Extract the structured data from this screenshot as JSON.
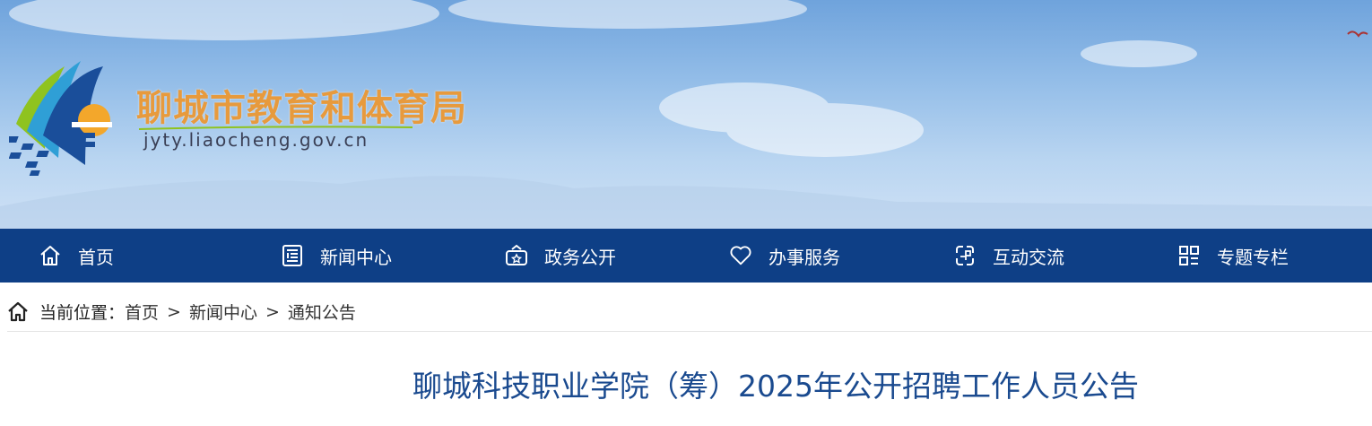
{
  "header": {
    "site_title": "聊城市教育和体育局",
    "site_domain": "jyty.liaocheng.gov.cn",
    "logo_icon": "liaocheng-education-logo-icon",
    "title_color": "#e79a3d"
  },
  "nav": {
    "background": "#0e3f86",
    "items": [
      {
        "label": "首页",
        "icon": "home-icon"
      },
      {
        "label": "新闻中心",
        "icon": "newspaper-icon"
      },
      {
        "label": "政务公开",
        "icon": "government-icon"
      },
      {
        "label": "办事服务",
        "icon": "heart-icon"
      },
      {
        "label": "互动交流",
        "icon": "interaction-icon"
      },
      {
        "label": "专题专栏",
        "icon": "grid-icon"
      }
    ]
  },
  "breadcrumb": {
    "prefix": "当前位置：",
    "items": [
      "首页",
      "新闻中心",
      "通知公告"
    ],
    "separator": ">"
  },
  "article": {
    "title": "聊城科技职业学院（筹）2025年公开招聘工作人员公告",
    "title_color": "#1a4a8f"
  }
}
